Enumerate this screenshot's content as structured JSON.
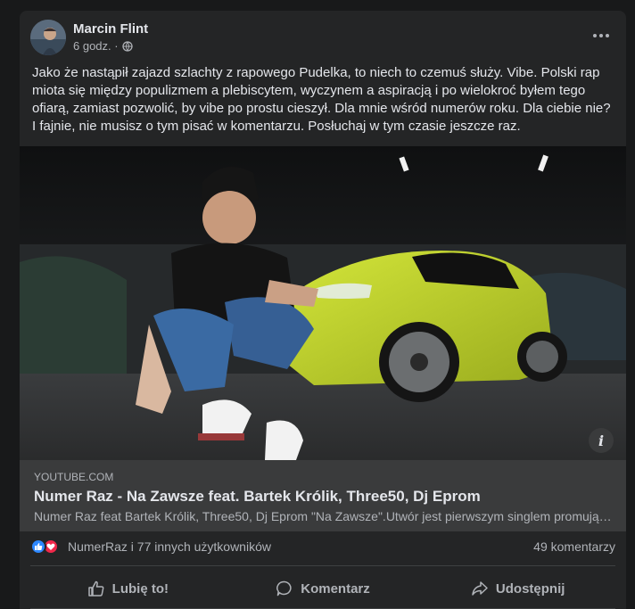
{
  "post": {
    "author": "Marcin Flint",
    "time": "6 godz. ·",
    "privacy_icon": "globe-icon",
    "text": "Jako że nastąpił zajazd szlachty z rapowego Pudelka, to niech to czemuś służy. Vibe. Polski rap miota się między populizmem a plebiscytem, wyczynem a aspiracją i po wielokroć byłem tego ofiarą, zamiast pozwolić, by vibe po prostu cieszył. Dla mnie wśród numerów roku. Dla ciebie nie? I fajnie, nie musisz o tym pisać w komentarzu. Posłuchaj w tym czasie jeszcze raz."
  },
  "link": {
    "domain": "YOUTUBE.COM",
    "title": "Numer Raz - Na Zawsze feat. Bartek Królik, Three50, Dj Eprom",
    "description": "Numer Raz feat Bartek Królik, Three50, Dj Eprom \"Na Zawsze\".Utwór jest pierwszym singlem promującym",
    "info_icon": "i"
  },
  "reactions": {
    "summary": "NumerRaz i 77 innych użytkowników",
    "comments": "49 komentarzy",
    "icons": [
      "like-icon",
      "love-icon"
    ]
  },
  "actions": {
    "like": "Lubię to!",
    "comment": "Komentarz",
    "share": "Udostępnij"
  },
  "colors": {
    "background": "#18191a",
    "card": "#242526",
    "link_box": "#3a3b3c",
    "like_blue": "#2d88ff",
    "love_red": "#f0284a",
    "car_lime": "#c2d62a"
  }
}
